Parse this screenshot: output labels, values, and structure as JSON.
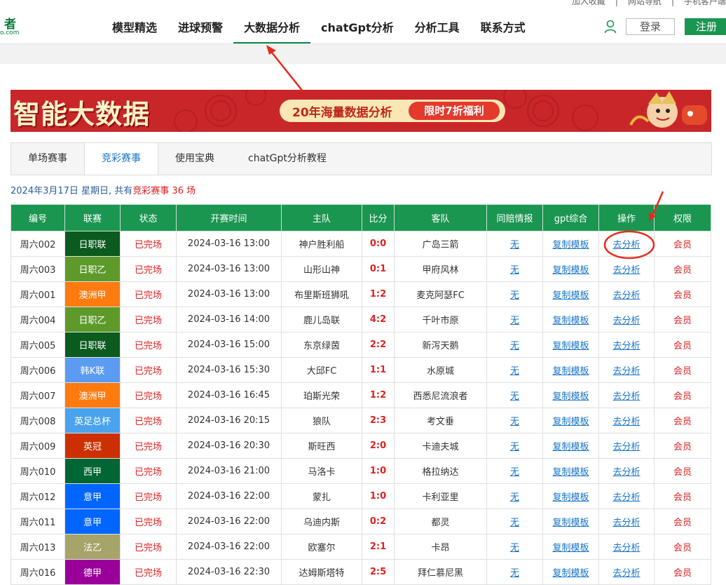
{
  "top_links": [
    "加入收藏",
    "网站导航",
    "手机客户端"
  ],
  "logo": {
    "char": "者",
    "domain": "o.com"
  },
  "nav": [
    "模型精选",
    "进球预警",
    "大数据分析",
    "chatGpt分析",
    "分析工具",
    "联系方式"
  ],
  "nav_active": 2,
  "header": {
    "login": "登录",
    "register": "注册"
  },
  "banner": {
    "title": "智能大数据",
    "pill_left": "20年海量数据分析",
    "pill_right": "限时7折福利"
  },
  "tabs": [
    "单场赛事",
    "竞彩赛事",
    "使用宝典",
    "chatGpt分析教程"
  ],
  "tab_active": 1,
  "dateline": {
    "prefix": "2024年3月17日 星期日, 共有",
    "highlight": "竞彩赛事 36 场"
  },
  "table": {
    "headers": [
      "编号",
      "联赛",
      "状态",
      "开赛时间",
      "主队",
      "比分",
      "客队",
      "同赔情报",
      "gpt综合",
      "操作",
      "权限"
    ],
    "rows": [
      {
        "id": "周六002",
        "league": "日职联",
        "lc": "#0b5a1e",
        "status": "已完场",
        "time": "2024-03-16 13:00",
        "home": "神户胜利船",
        "score": "0:0",
        "away": "广岛三箭",
        "odds": "无",
        "gpt": "复制模板",
        "op": "去分析",
        "vip": "会员"
      },
      {
        "id": "周六003",
        "league": "日职乙",
        "lc": "#5e9a2a",
        "status": "已完场",
        "time": "2024-03-16 13:00",
        "home": "山形山神",
        "score": "0:1",
        "away": "甲府风林",
        "odds": "无",
        "gpt": "复制模板",
        "op": "去分析",
        "vip": "会员"
      },
      {
        "id": "周六001",
        "league": "澳洲甲",
        "lc": "#ff7b0f",
        "status": "已完场",
        "time": "2024-03-16 13:00",
        "home": "布里斯班狮吼",
        "score": "1:2",
        "away": "麦克阿瑟FC",
        "odds": "无",
        "gpt": "复制模板",
        "op": "去分析",
        "vip": "会员"
      },
      {
        "id": "周六004",
        "league": "日职乙",
        "lc": "#5e9a2a",
        "status": "已完场",
        "time": "2024-03-16 14:00",
        "home": "鹿儿岛联",
        "score": "4:2",
        "away": "千叶市原",
        "odds": "无",
        "gpt": "复制模板",
        "op": "去分析",
        "vip": "会员"
      },
      {
        "id": "周六005",
        "league": "日职联",
        "lc": "#0b5a1e",
        "status": "已完场",
        "time": "2024-03-16 15:00",
        "home": "东京绿茵",
        "score": "2:2",
        "away": "新泻天鹅",
        "odds": "无",
        "gpt": "复制模板",
        "op": "去分析",
        "vip": "会员"
      },
      {
        "id": "周六006",
        "league": "韩K联",
        "lc": "#5b9cf2",
        "status": "已完场",
        "time": "2024-03-16 15:30",
        "home": "大邱FC",
        "score": "1:1",
        "away": "水原城",
        "odds": "无",
        "gpt": "复制模板",
        "op": "去分析",
        "vip": "会员"
      },
      {
        "id": "周六007",
        "league": "澳洲甲",
        "lc": "#ff7b0f",
        "status": "已完场",
        "time": "2024-03-16 16:45",
        "home": "珀斯光荣",
        "score": "1:2",
        "away": "西悉尼流浪者",
        "odds": "无",
        "gpt": "复制模板",
        "op": "去分析",
        "vip": "会员"
      },
      {
        "id": "周六008",
        "league": "英足总杯",
        "lc": "#4aa3ec",
        "status": "已完场",
        "time": "2024-03-16 20:15",
        "home": "狼队",
        "score": "2:3",
        "away": "考文垂",
        "odds": "无",
        "gpt": "复制模板",
        "op": "去分析",
        "vip": "会员"
      },
      {
        "id": "周六009",
        "league": "英冠",
        "lc": "#cc3000",
        "status": "已完场",
        "time": "2024-03-16 20:30",
        "home": "斯旺西",
        "score": "2:0",
        "away": "卡迪夫城",
        "odds": "无",
        "gpt": "复制模板",
        "op": "去分析",
        "vip": "会员"
      },
      {
        "id": "周六010",
        "league": "西甲",
        "lc": "#006633",
        "status": "已完场",
        "time": "2024-03-16 21:00",
        "home": "马洛卡",
        "score": "1:0",
        "away": "格拉纳达",
        "odds": "无",
        "gpt": "复制模板",
        "op": "去分析",
        "vip": "会员"
      },
      {
        "id": "周六012",
        "league": "意甲",
        "lc": "#0066ff",
        "status": "已完场",
        "time": "2024-03-16 22:00",
        "home": "蒙扎",
        "score": "1:0",
        "away": "卡利亚里",
        "odds": "无",
        "gpt": "复制模板",
        "op": "去分析",
        "vip": "会员"
      },
      {
        "id": "周六011",
        "league": "意甲",
        "lc": "#0066ff",
        "status": "已完场",
        "time": "2024-03-16 22:00",
        "home": "乌迪内斯",
        "score": "0:2",
        "away": "都灵",
        "odds": "无",
        "gpt": "复制模板",
        "op": "去分析",
        "vip": "会员"
      },
      {
        "id": "周六013",
        "league": "法乙",
        "lc": "#a7a46a",
        "status": "已完场",
        "time": "2024-03-16 22:00",
        "home": "欧塞尔",
        "score": "2:1",
        "away": "卡昂",
        "odds": "无",
        "gpt": "复制模板",
        "op": "去分析",
        "vip": "会员"
      },
      {
        "id": "周六016",
        "league": "德甲",
        "lc": "#990099",
        "status": "已完场",
        "time": "2024-03-16 22:30",
        "home": "达姆斯塔特",
        "score": "2:5",
        "away": "拜仁慕尼黑",
        "odds": "无",
        "gpt": "复制模板",
        "op": "去分析",
        "vip": "会员"
      }
    ]
  },
  "colors": {
    "accent": "#1a9650",
    "status": "#e02020",
    "link": "#1a76c8",
    "banner": "#c9262a",
    "annotation": "#e62a1a"
  }
}
